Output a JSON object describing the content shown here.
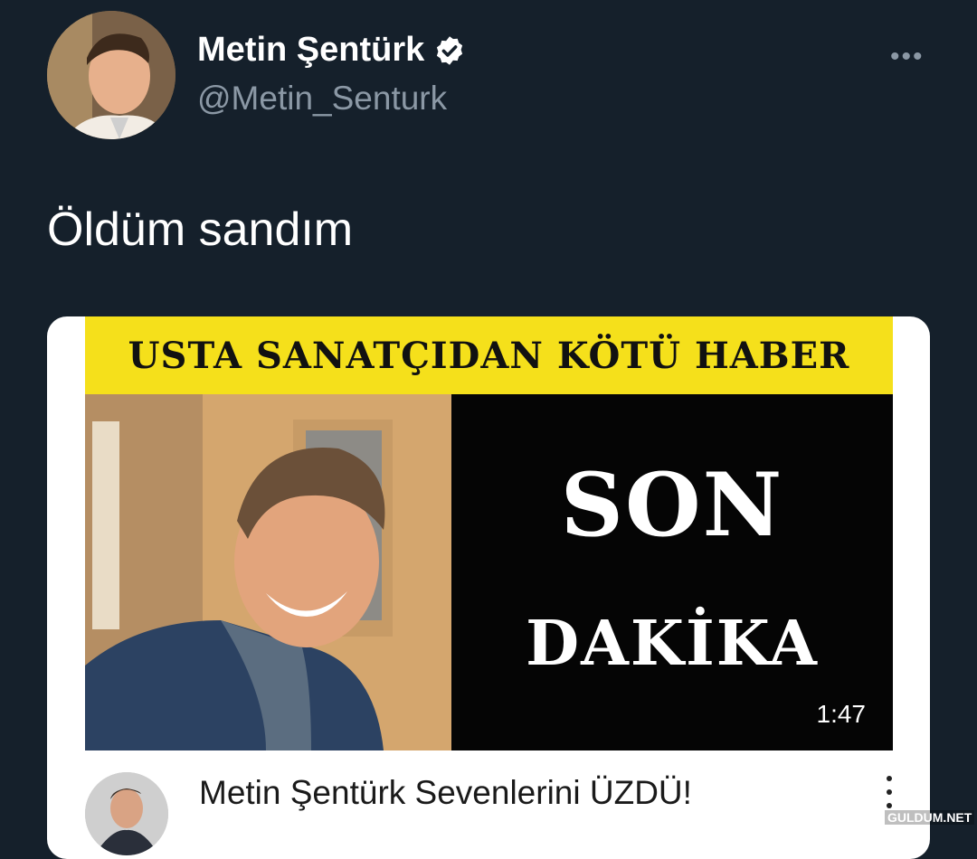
{
  "tweet": {
    "display_name": "Metin Şentürk",
    "handle": "@Metin_Senturk",
    "verified": true,
    "text": "Öldüm sandım",
    "more_label": "•••"
  },
  "video_card": {
    "banner_text": "USTA SANATÇIDAN KÖTÜ HABER",
    "headline_top": "SON",
    "headline_bottom": "DAKİKA",
    "duration": "1:47",
    "title": "Metin Şentürk Sevenlerini ÜZDÜ!",
    "meta": ""
  },
  "watermark": "GULDUM.NET",
  "colors": {
    "background": "#15202b",
    "secondary_text": "#8b98a5",
    "banner_yellow": "#f5e01b"
  }
}
